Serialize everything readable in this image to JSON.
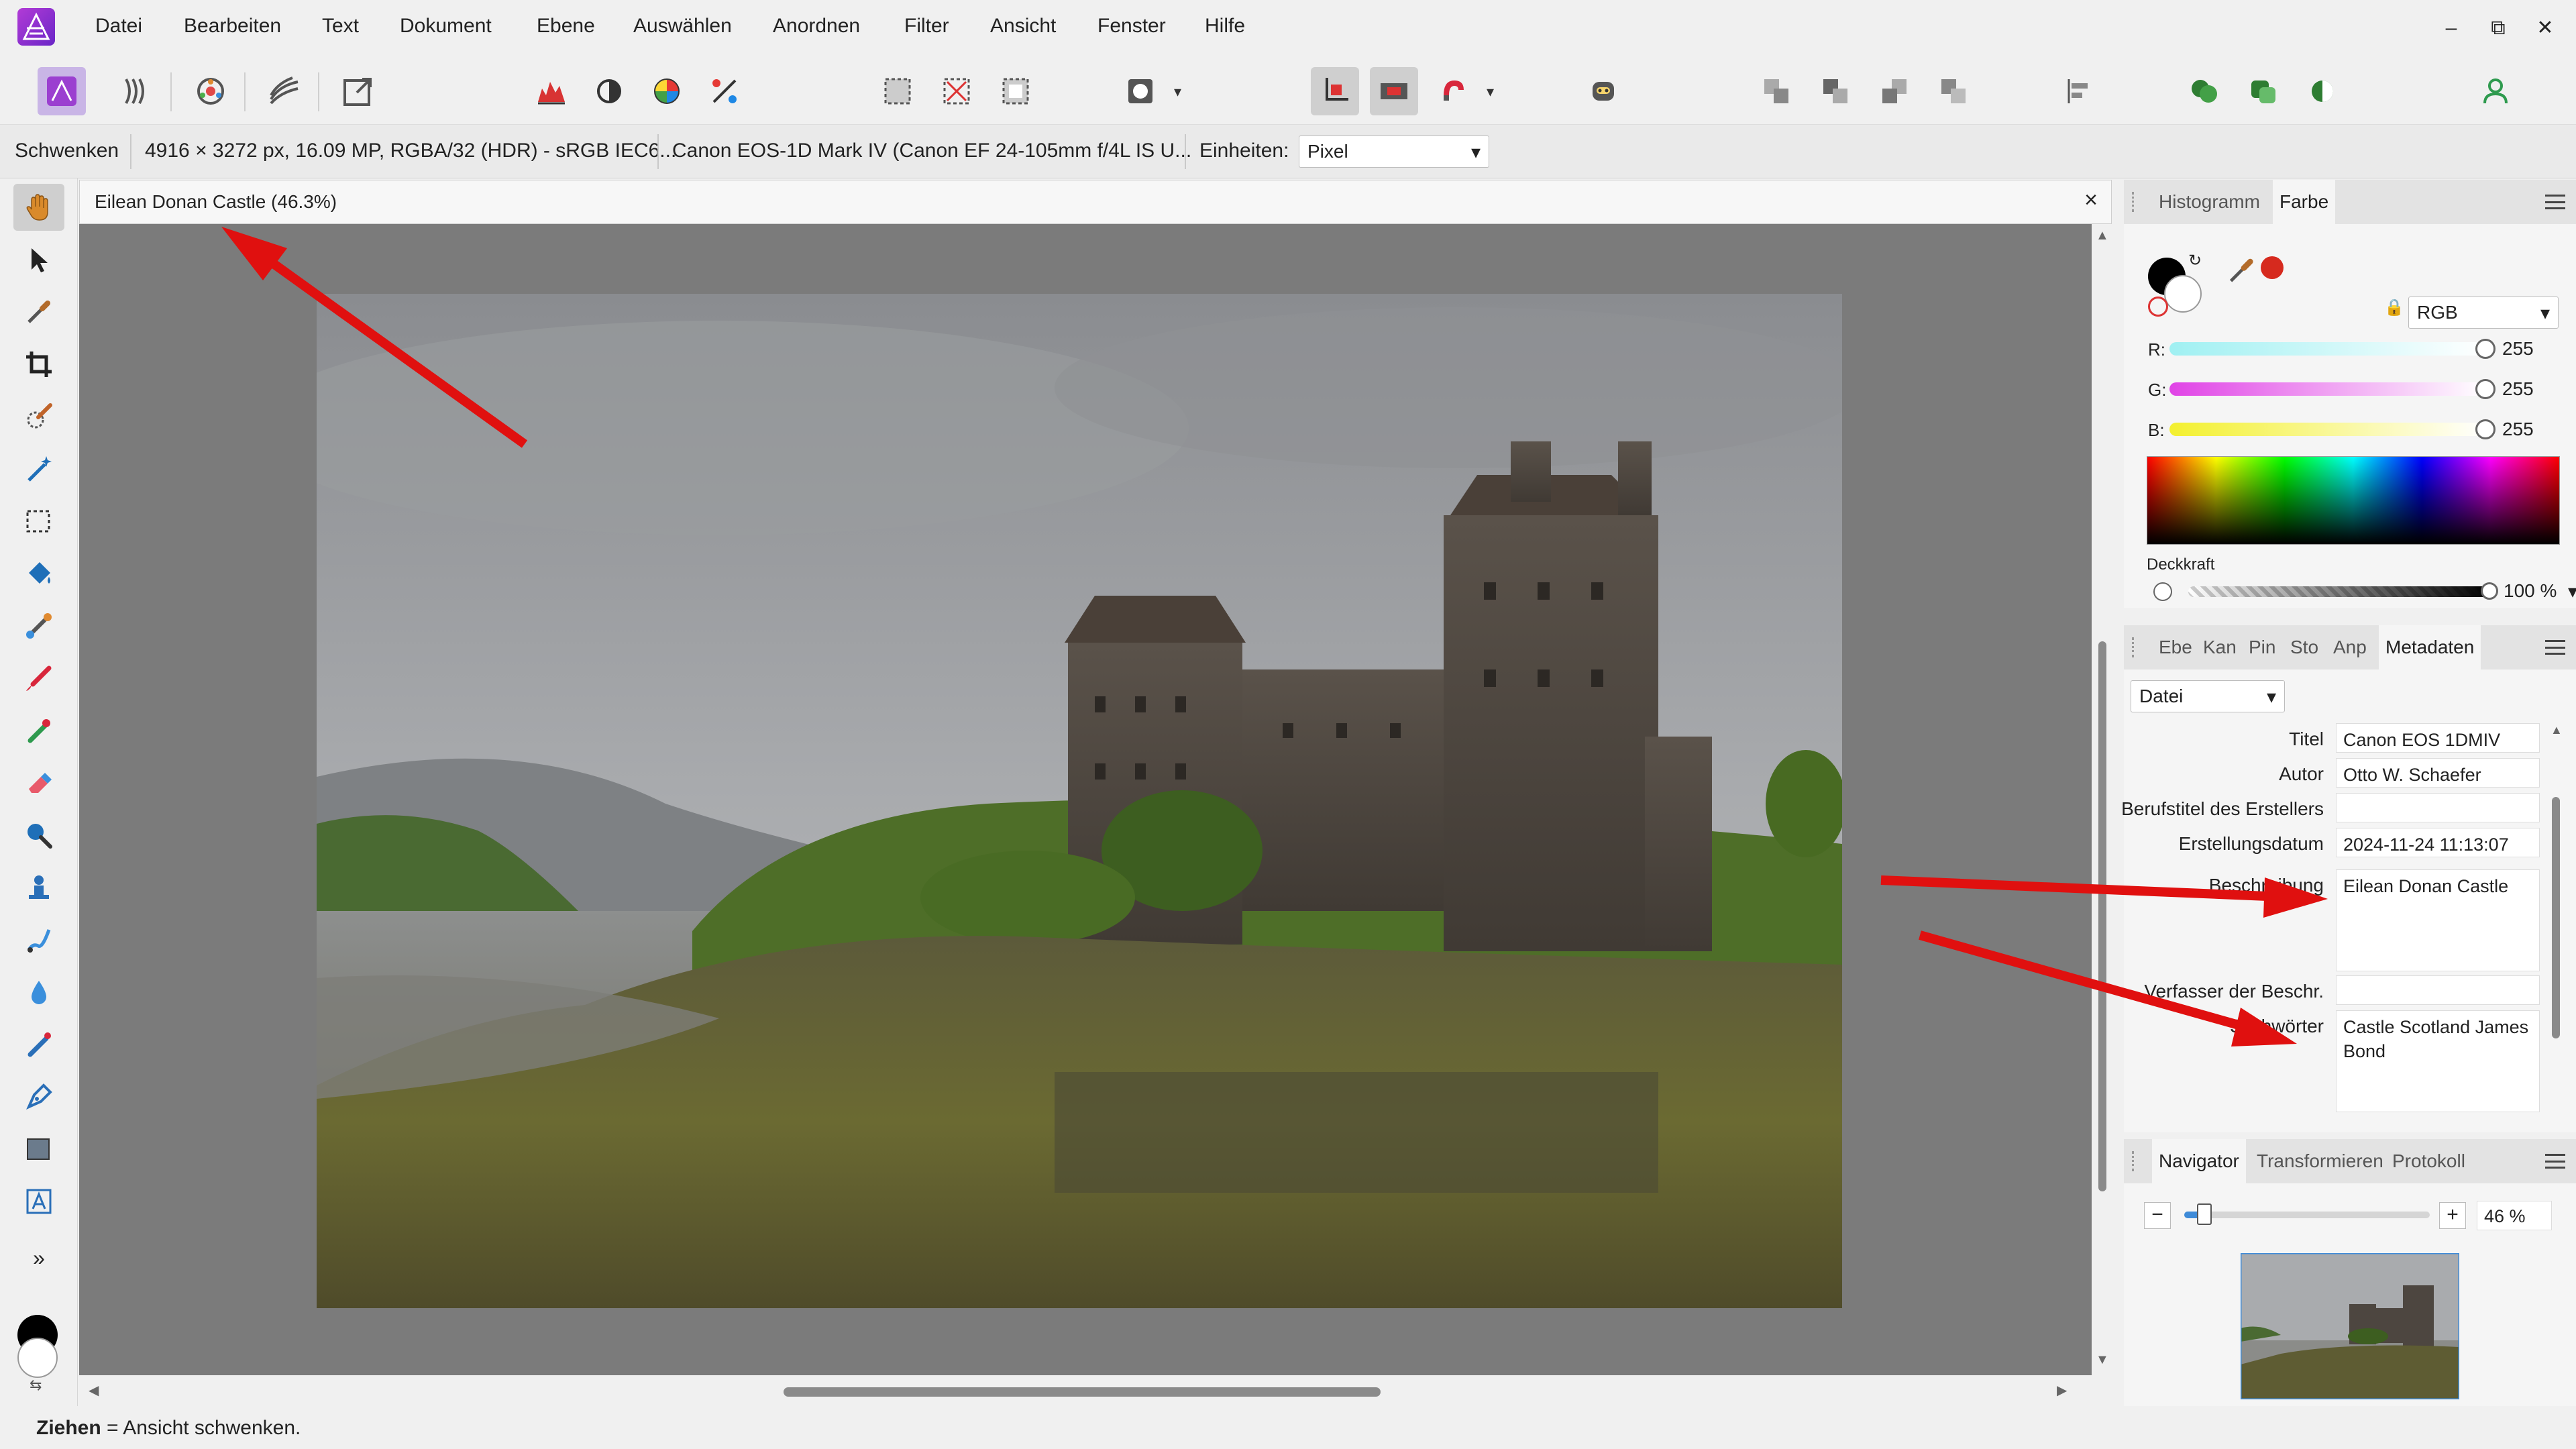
{
  "menu": [
    "Datei",
    "Bearbeiten",
    "Text",
    "Dokument",
    "Ebene",
    "Auswählen",
    "Anordnen",
    "Filter",
    "Ansicht",
    "Fenster",
    "Hilfe"
  ],
  "window_controls": {
    "minimize": "–",
    "restore": "⧉",
    "close": "✕"
  },
  "context": {
    "tool_name": "Schwenken",
    "image_info": "4916 × 3272 px, 16.09 MP, RGBA/32 (HDR) - sRGB IEC6...",
    "camera_info": "Canon EOS-1D Mark IV (Canon EF 24-105mm f/4L IS U...",
    "units_label": "Einheiten:",
    "units_value": "Pixel"
  },
  "document": {
    "tab_title": "Eilean Donan Castle (46.3%)",
    "close": "×"
  },
  "status": {
    "bold": "Ziehen",
    "text": " = Ansicht schwenken."
  },
  "color_panel": {
    "tabs": [
      "Histogramm",
      "Farbe"
    ],
    "active_tab": "Farbe",
    "model": "RGB",
    "r_label": "R:",
    "g_label": "G:",
    "b_label": "B:",
    "r": "255",
    "g": "255",
    "b": "255",
    "opacity_label": "Deckkraft",
    "opacity": "100 %",
    "opacity_level": 1.0,
    "colors": {
      "primary": "#000000",
      "secondary": "#ffffff",
      "recent": "#d62a1e"
    }
  },
  "meta_panel": {
    "tabs": [
      "Ebe",
      "Kan",
      "Pin",
      "Sto",
      "Anp",
      "Metadaten"
    ],
    "active_tab": "Metadaten",
    "category": "Datei",
    "fields": [
      {
        "label": "Titel",
        "value": "Canon EOS 1DMIV"
      },
      {
        "label": "Autor",
        "value": "Otto W. Schaefer"
      },
      {
        "label": "Berufstitel des Erstellers",
        "value": ""
      },
      {
        "label": "Erstellungsdatum",
        "value": "2024-11-24 11:13:07"
      },
      {
        "label": "Beschreibung",
        "value": "Eilean Donan Castle"
      },
      {
        "label": "Verfasser der Beschr.",
        "value": ""
      },
      {
        "label": "Stichwörter",
        "value": "Castle Scotland James Bond"
      }
    ]
  },
  "navigator_panel": {
    "tabs": [
      "Navigator",
      "Transformieren",
      "Protokoll"
    ],
    "active_tab": "Navigator",
    "zoom": "46 %",
    "zoom_level": 0.46,
    "minus": "−",
    "plus": "+"
  },
  "annotation_color": "#e0100f"
}
